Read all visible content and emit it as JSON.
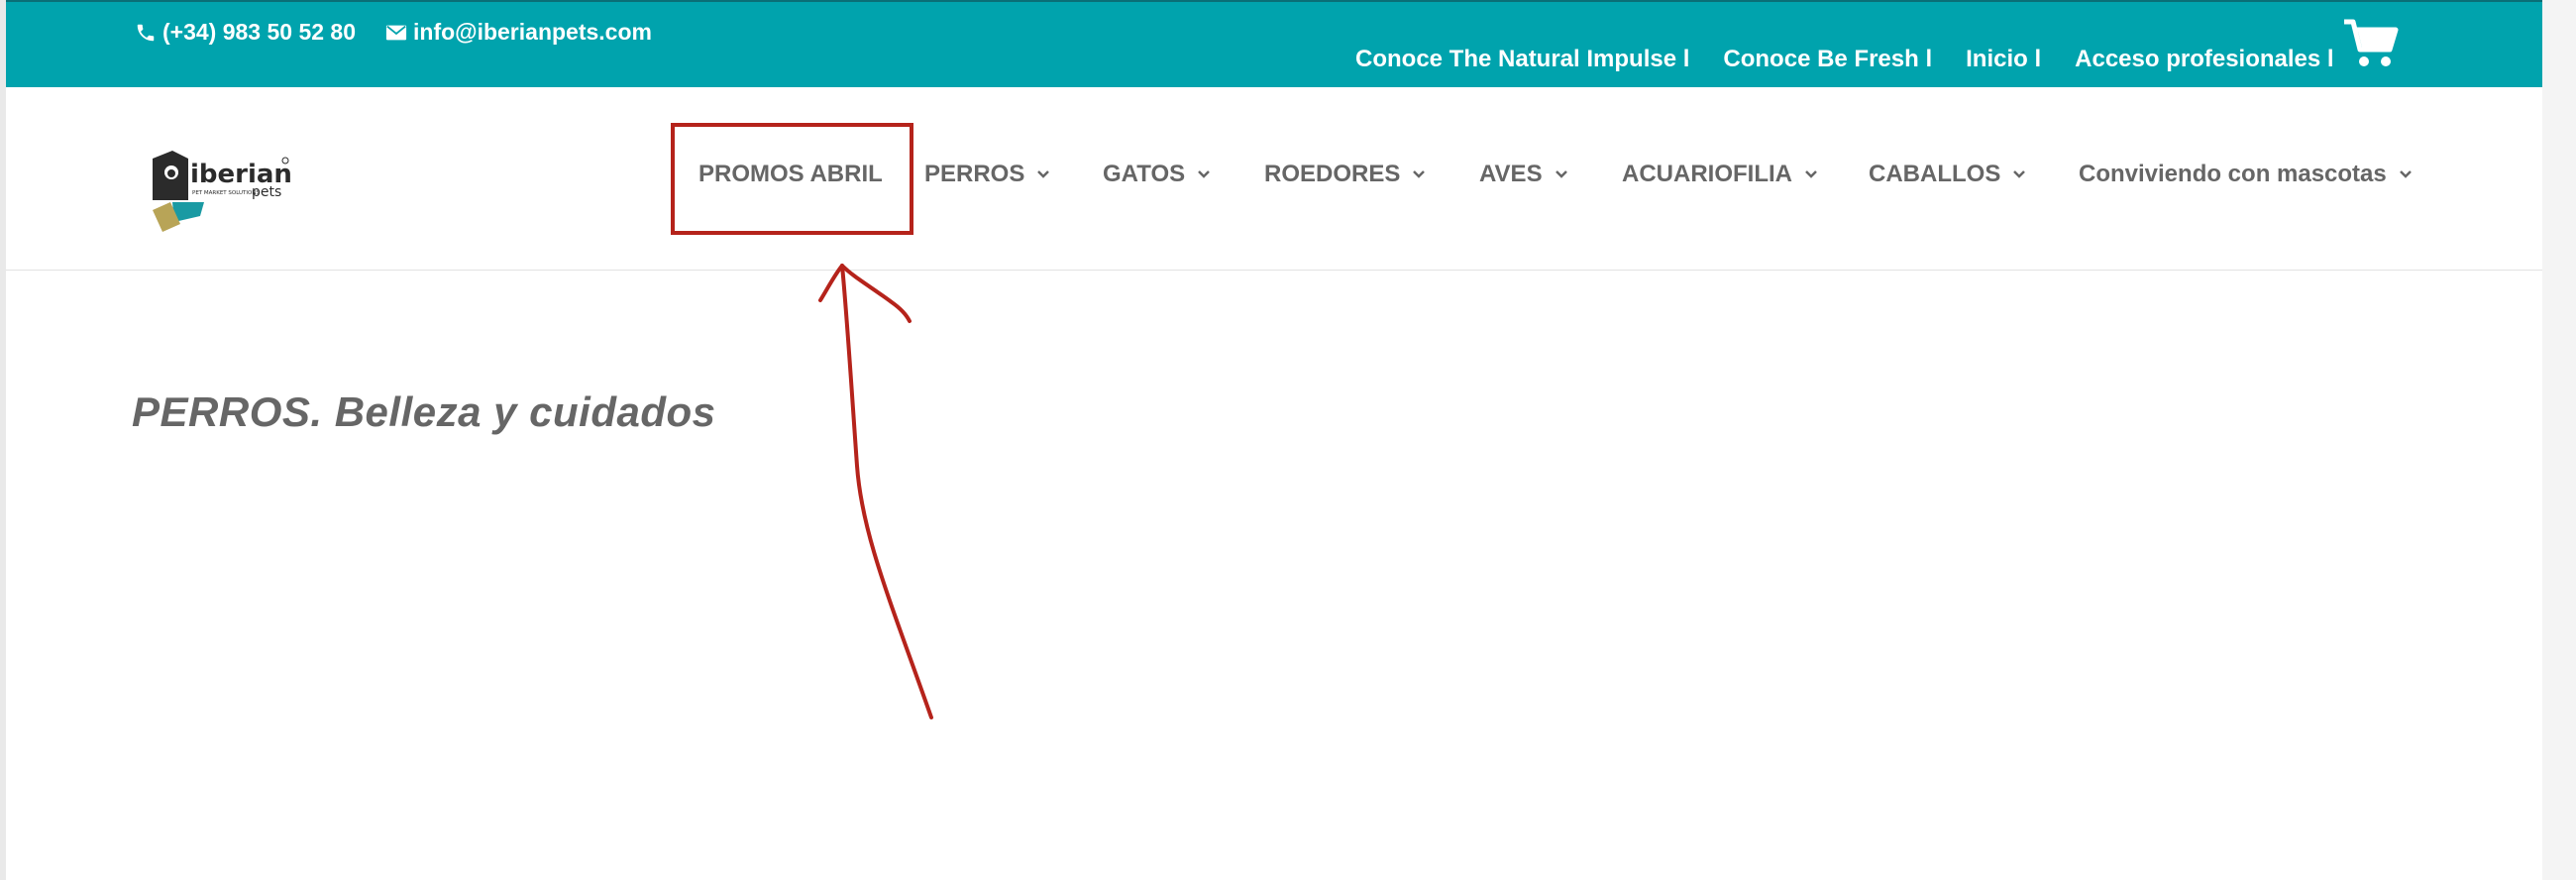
{
  "topbar": {
    "phone": "(+34) 983 50 52 80",
    "email": "info@iberianpets.com",
    "links": [
      "Conoce The Natural Impulse l",
      "Conoce Be Fresh l",
      "Inicio l",
      "Acceso profesionales l"
    ],
    "bg_color": "#00a3ad",
    "cart_icon": "cart-icon"
  },
  "logo": {
    "wordmark": "iberian",
    "sub": "pets",
    "tagline": "PET MARKET SOLUTIONS"
  },
  "nav": {
    "items": [
      "PROMOS ABRIL",
      "PERROS",
      "GATOS",
      "ROEDORES",
      "AVES",
      "ACUARIOFILIA",
      "CABALLOS",
      "Conviviendo con mascotas"
    ]
  },
  "page": {
    "title": "PERROS. Belleza y cuidados"
  },
  "annotation": {
    "color": "#b5231b",
    "highlighted": "PROMOS ABRIL"
  }
}
